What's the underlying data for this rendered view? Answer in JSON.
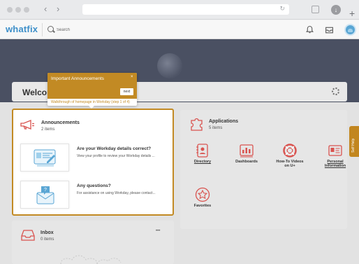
{
  "browser": {
    "back_glyph": "‹",
    "forward_glyph": "›",
    "reload_glyph": "↻",
    "new_tab_glyph": "+"
  },
  "header": {
    "logo": "whatfix",
    "search_placeholder": "Search",
    "icons": [
      "bell-icon",
      "inbox-icon",
      "user-avatar"
    ]
  },
  "welcome": {
    "text": "Welcom"
  },
  "tooltip": {
    "title": "Important Announcements",
    "close": "×",
    "next_label": "next",
    "step_text": "Walkthrough of homepage in Workday (step 1 of 4)"
  },
  "announcements": {
    "title": "Announcements",
    "count": "2 items",
    "items": [
      {
        "title": "Are your Workday details correct?",
        "desc": "View your profile to review your Workday details ..."
      },
      {
        "title": "Any questions?",
        "desc": "For assistance on using Workday, please contact..."
      }
    ]
  },
  "applications": {
    "title": "Applications",
    "count": "5 items",
    "apps": [
      {
        "label": "Directory",
        "icon": "directory-icon"
      },
      {
        "label": "Dashboards",
        "icon": "dashboards-icon"
      },
      {
        "label": "How-To Videos on U+",
        "icon": "lifebuoy-icon"
      },
      {
        "label": "Personal Information",
        "icon": "personal-info-icon"
      },
      {
        "label": "Favorites",
        "icon": "star-icon"
      }
    ]
  },
  "inbox": {
    "title": "Inbox",
    "count": "0 items",
    "menu": "•••"
  },
  "self_help": {
    "label": "Self Help"
  },
  "colors": {
    "accent": "#c28a24",
    "brand": "#3d8fc9",
    "icon_red": "#d9534f"
  }
}
